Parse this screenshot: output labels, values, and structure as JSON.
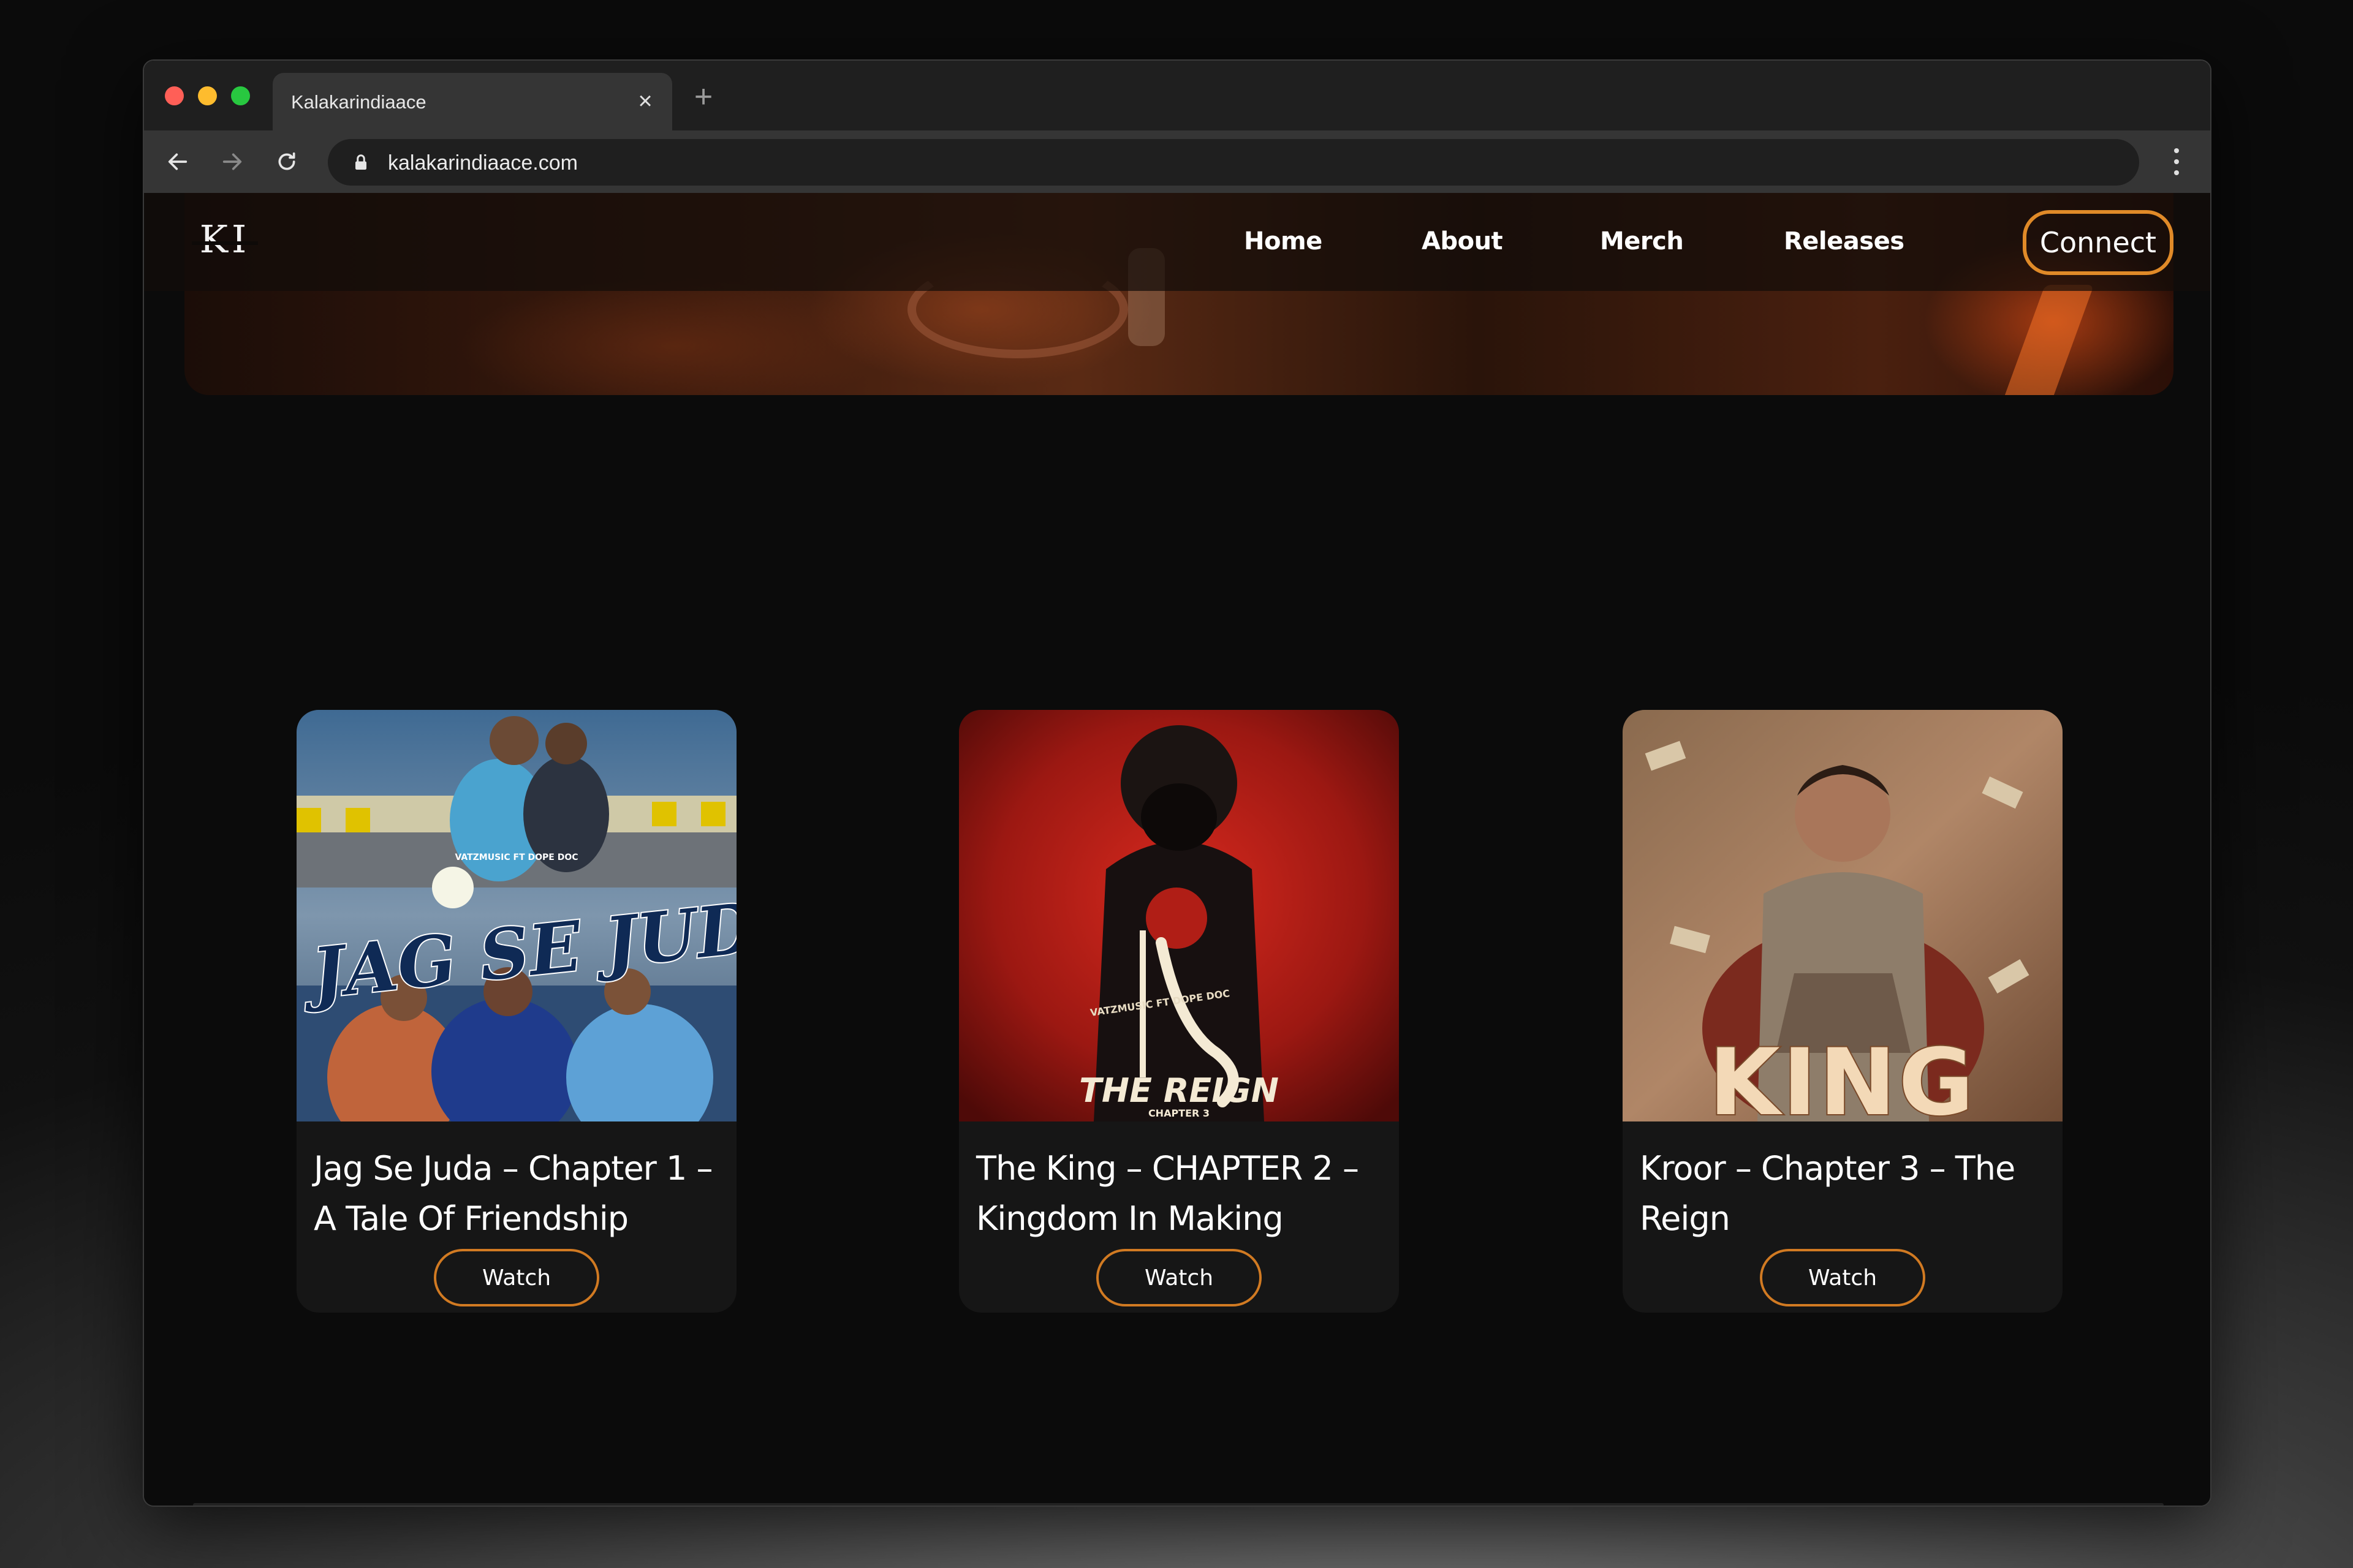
{
  "browser": {
    "tab_title": "Kalakarindiaace",
    "url": "kalakarindiaace.com"
  },
  "site": {
    "logo_text": "KI",
    "nav": {
      "home": "Home",
      "about": "About",
      "merch": "Merch",
      "releases": "Releases",
      "connect": "Connect"
    }
  },
  "releases": [
    {
      "title": "Jag Se Juda – Chapter 1 – A Tale Of Friendship",
      "poster_text": "JAG SE JUDA",
      "poster_credit": "VATZMUSIC FT DOPE DOC",
      "button": "Watch"
    },
    {
      "title": "The King – CHAPTER 2 – Kingdom In Making",
      "poster_text": "THE REIGN",
      "poster_credit": "VATZMUSIC FT DOPE DOC",
      "poster_sub": "CHAPTER 3",
      "button": "Watch"
    },
    {
      "title": "Kroor – Chapter 3 – The Reign",
      "poster_text": "KING",
      "button": "Watch"
    }
  ],
  "colors": {
    "accent": "#e08a28",
    "page_bg": "#0b0b0b",
    "card_bg": "#161616"
  }
}
